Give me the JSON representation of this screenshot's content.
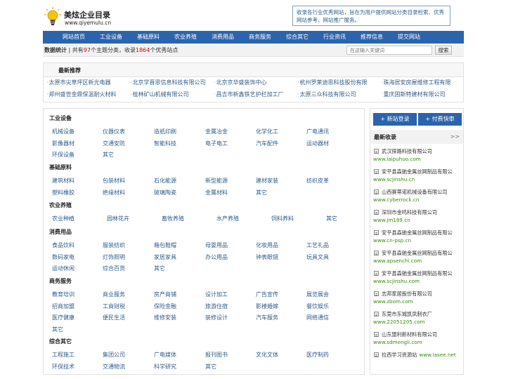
{
  "logo": {
    "title": "美炫企业目录",
    "url": "www.qiyemulu.cn"
  },
  "intro": "收录各行业优秀网站，旨在为用户提供网站分类目录检索、优秀网站参考、网站推广服务。",
  "nav": [
    "网站首页",
    "工业设备",
    "基础原料",
    "农业养殖",
    "消费用品",
    "商务服务",
    "综合其它",
    "行业资讯",
    "推荐信息",
    "提交网站"
  ],
  "stats": {
    "label": "数据统计",
    "prefix": "共有",
    "topic_count": "97",
    "middle": "个主题分类，收录",
    "site_count": "1864",
    "suffix": "个优秀站点"
  },
  "search": {
    "placeholder": "在这输入关键词",
    "button": "搜索"
  },
  "recommend": {
    "title": "最新推荐",
    "items": [
      "太原市尖草坪区新光电器",
      "北京学晋思信息科技有限公司",
      "北京京华盛装饰中心",
      "杭州罗莱迪思科技股份有限",
      "珠海居安房屋维修工程有限",
      "郑州盛世金鼎保温耐火材料",
      "桂林矿山机械有限公司",
      "昌吉市新鑫铁艺护栏加工厂",
      "太原三众科技有限公司",
      "重庆固斯特建材有限公司"
    ]
  },
  "categories": [
    {
      "title": "工业设备",
      "items": [
        "机械设备",
        "仪器仪表",
        "造纸印刷",
        "金属冶金",
        "化学化工",
        "广电通讯",
        "影像器材",
        "交通安防",
        "智能科技",
        "电子电工",
        "汽车配件",
        "运动器材",
        "环保设备",
        "其它"
      ]
    },
    {
      "title": "基础原料",
      "items": [
        "建筑材料",
        "包装材料",
        "石化能源",
        "新型能源",
        "建材家装",
        "纺织皮革",
        "塑料橡胶",
        "绝缘材料",
        "玻璃陶瓷",
        "金属材料",
        "其它"
      ]
    },
    {
      "title": "农业养殖",
      "items": [
        "农业种植",
        "园林花卉",
        "畜牧养殖",
        "水产养殖",
        "饲料养料",
        "其它"
      ]
    },
    {
      "title": "消费用品",
      "items": [
        "食品饮料",
        "服装纺织",
        "箱包鞋帽",
        "母婴用品",
        "化妆用品",
        "工艺礼品",
        "数码家电",
        "灯饰照明",
        "家居家具",
        "办公用品",
        "钟表眼镜",
        "玩具文具",
        "运动休闲",
        "综合百货",
        "其它"
      ]
    },
    {
      "title": "商务服务",
      "items": [
        "教育培训",
        "商业服务",
        "房产商铺",
        "设计加工",
        "广告宣传",
        "展览展会",
        "招商加盟",
        "工商财税",
        "保险金融",
        "旅游住宿",
        "影楼婚嫁",
        "餐饮娱乐",
        "医疗健康",
        "便民生活",
        "维修安装",
        "装修设计",
        "汽车服务",
        "网络通信",
        "其它"
      ]
    },
    {
      "title": "综合其它",
      "items": [
        "工程施工",
        "集团公司",
        "广电媒体",
        "报刊图书",
        "文化文体",
        "医疗制药",
        "环保技术",
        "交通物流",
        "科学研究",
        "其它"
      ]
    }
  ],
  "sidebar": {
    "submit_button": "+ 新站登录",
    "paid_button": "+ 付费快审",
    "recent_title": "最新收录",
    "more": ">>",
    "recent": [
      {
        "name": "武汉探路科技有限公司",
        "url": "www.laipuhuo.com"
      },
      {
        "name": "安平县森驰金属丝网制品有限公",
        "url": "www.scjinshu.cn"
      },
      {
        "name": "山西赛蒂诺机械设备有限公司",
        "url": "www.cyberrock.cn"
      },
      {
        "name": "深圳市金鸣科技有限公司",
        "url": "www.jm189.cn"
      },
      {
        "name": "安平县森驰金属丝网制品有限公",
        "url": "www.cn-psp.cn"
      },
      {
        "name": "安平县森驰金属丝网制品有限公",
        "url": "www.apsenchi.com"
      },
      {
        "name": "安平县森驰金属丝网制品有限公",
        "url": "www.scjinshu.com"
      },
      {
        "name": "志邦家居股份有限公司",
        "url": "www.zbom.com"
      },
      {
        "name": "东莞市东城凯凤制衣厂",
        "url": "www.22051205.com"
      },
      {
        "name": "山东盟利新材料有限公司",
        "url": "www.sdmengli.com"
      },
      {
        "name": "拉西学习资源站",
        "url": "www.lasee.net"
      }
    ]
  }
}
